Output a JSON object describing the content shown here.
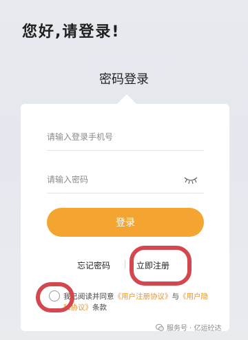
{
  "greeting": "您好,请登录!",
  "tab_title": "密码登录",
  "form": {
    "phone_placeholder": "请输入登录手机号",
    "password_placeholder": "请输入密码",
    "login_label": "登录"
  },
  "links": {
    "forgot": "忘记密码",
    "register": "立即注册"
  },
  "agreement": {
    "prefix": "我已阅读并同意",
    "user_agreement": "《用户注册协议》",
    "and": "与",
    "privacy": "《用户隐私协议》",
    "suffix": "条款"
  },
  "watermark": "服务号 · 亿运砼达",
  "colors": {
    "accent": "#f4a531",
    "highlight_ring": "#d3474f"
  },
  "icons": [
    "eye-closed-icon",
    "wechat-icon"
  ]
}
